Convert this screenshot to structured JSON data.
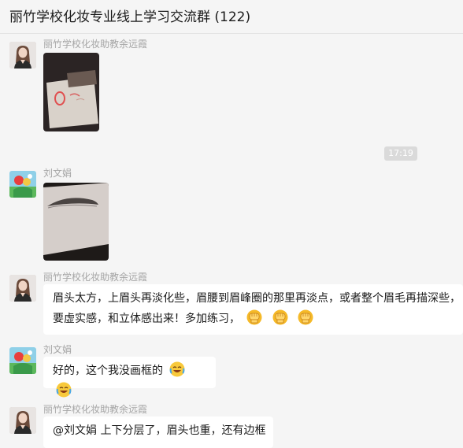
{
  "chat": {
    "title": "丽竹学校化妆专业线上学习交流群 (122)"
  },
  "timestamp": "17:19",
  "messages": [
    {
      "sender": "丽竹学校化妆助教余远霞"
    },
    {
      "sender": "刘文娟"
    },
    {
      "sender": "丽竹学校化妆助教余远霞",
      "text_line1": "眉头太方，上眉头再淡化些，眉腰到眉峰圈的那里再淡点，或者整个眉毛再描深些，",
      "text_line2": "要虚实感，和立体感出来！多加练习，"
    },
    {
      "sender": "刘文娟",
      "text": "好的，这个我没画框的"
    },
    {
      "sender": "丽竹学校化妆助教余远霞",
      "text": "@刘文娟 上下分层了，眉头也重，还有边框"
    }
  ],
  "emoji_names": [
    "fist-emoji",
    "laughing-tears-emoji"
  ]
}
